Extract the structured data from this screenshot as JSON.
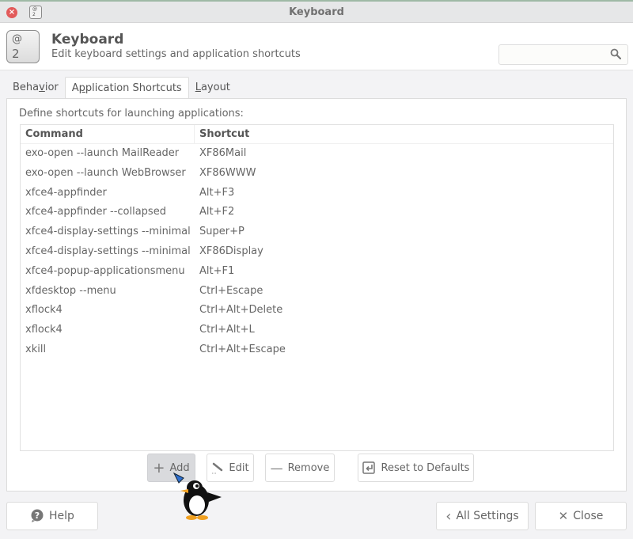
{
  "window": {
    "title": "Keyboard",
    "close_icon": "close-icon",
    "app_icon": "keyboard-icon"
  },
  "header": {
    "title": "Keyboard",
    "subtitle": "Edit keyboard settings and application shortcuts",
    "icon_text_top": "@",
    "icon_text_bottom": "2",
    "search": {
      "value": "",
      "placeholder": "",
      "icon": "search-icon"
    }
  },
  "tabs": [
    {
      "label": "Behavior",
      "active": false
    },
    {
      "label": "Application Shortcuts",
      "active": true
    },
    {
      "label": "Layout",
      "active": false
    }
  ],
  "panel": {
    "label": "Define shortcuts for launching applications:",
    "columns": [
      "Command",
      "Shortcut"
    ],
    "rows": [
      {
        "command": "exo-open --launch MailReader",
        "shortcut": "XF86Mail"
      },
      {
        "command": "exo-open --launch WebBrowser",
        "shortcut": "XF86WWW"
      },
      {
        "command": "xfce4-appfinder",
        "shortcut": "Alt+F3"
      },
      {
        "command": "xfce4-appfinder --collapsed",
        "shortcut": "Alt+F2"
      },
      {
        "command": "xfce4-display-settings --minimal",
        "shortcut": "Super+P"
      },
      {
        "command": "xfce4-display-settings --minimal",
        "shortcut": "XF86Display"
      },
      {
        "command": "xfce4-popup-applicationsmenu",
        "shortcut": "Alt+F1"
      },
      {
        "command": "xfdesktop --menu",
        "shortcut": "Ctrl+Escape"
      },
      {
        "command": "xflock4",
        "shortcut": "Ctrl+Alt+Delete"
      },
      {
        "command": "xflock4",
        "shortcut": "Ctrl+Alt+L"
      },
      {
        "command": "xkill",
        "shortcut": "Ctrl+Alt+Escape"
      }
    ],
    "buttons": {
      "add": "Add",
      "edit": "Edit",
      "remove": "Remove",
      "reset": "Reset to Defaults"
    }
  },
  "footer": {
    "help": "Help",
    "all_settings": "All Settings",
    "close": "Close"
  }
}
